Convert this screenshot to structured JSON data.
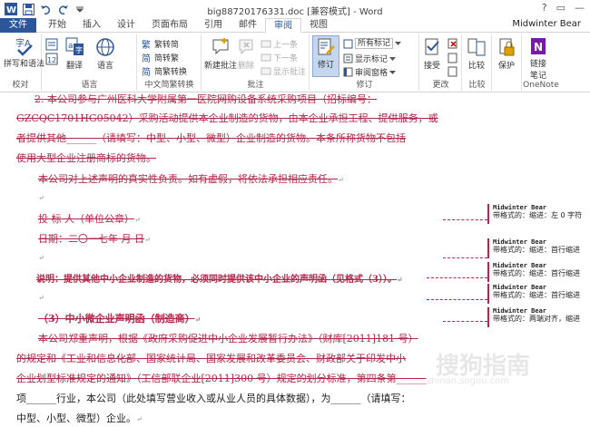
{
  "window": {
    "title": "big88720176331.doc [兼容模式] - Word",
    "controls": [
      "?",
      "▭",
      "—"
    ]
  },
  "tabs": {
    "file": "文件",
    "items": [
      "开始",
      "插入",
      "设计",
      "页面布局",
      "引用",
      "邮件",
      "审阅",
      "视图"
    ],
    "active": "审阅",
    "user": "Midwinter Bear"
  },
  "ribbon": {
    "proofing": {
      "label": "校对",
      "spelling": "拼写和语法"
    },
    "language": {
      "label": "语言",
      "translate": "翻译",
      "language": "语言"
    },
    "chinese": {
      "label": "中文简繁转换",
      "to_trad": "繁转简",
      "to_simp": "简转繁",
      "convert": "简繁转换"
    },
    "comments": {
      "label": "批注",
      "new": "新建批注",
      "delete": "删除",
      "prev": "上一条",
      "next": "下一条",
      "show": "显示批注"
    },
    "tracking": {
      "label": "修订",
      "track": "修订",
      "markup": "所有标记",
      "show_markup": "显示标记",
      "pane": "审阅窗格"
    },
    "changes": {
      "label": "更改",
      "accept": "接受"
    },
    "compare": {
      "label": "比较",
      "compare": "比较"
    },
    "protect": {
      "label": "",
      "protect": "保护"
    },
    "onenote": {
      "label": "OneNote",
      "linked": "链接",
      "notes": "笔记"
    }
  },
  "document": {
    "lines": [
      {
        "text": "2. 本公司参与广州医科大学附属第一医院网购设备系统采购项目（招标编号：",
        "style": "del"
      },
      {
        "text": "GZCQC1701HG05042）采购活动提供本企业制造的货物，由本企业承担工程、提供服务，或",
        "style": "del"
      },
      {
        "text": "者提供其他______（请填写：中型、小型、微型）企业制造的货物。本条所称货物不包括",
        "style": "del"
      },
      {
        "text": "使用大型企业注册商标的货物。",
        "style": "del"
      },
      {
        "text": "本公司对上述声明的真实性负责。如有虚假，将依法承担相应责任。",
        "style": "del"
      },
      {
        "text": "投 标 人（单位公章）",
        "style": "del"
      },
      {
        "text": "日期：二〇一七年    月    日",
        "style": "del"
      },
      {
        "text": "说明：提供其他中小企业制造的货物，必须同时提供该中小企业的声明函（见格式（3））。",
        "style": "del"
      },
      {
        "text": "（3）中小微企业声明函（制造商）",
        "style": "del"
      },
      {
        "text": "本公司郑重声明，根据《政府采购促进中小企业发展暂行办法》（财库[2011]181 号）",
        "style": "del"
      },
      {
        "text": "的规定和《工业和信息化部、国家统计局、国家发展和改革委员会、财政部关于印发中小",
        "style": "del"
      },
      {
        "text": "企业划型标准规定的通知》（工信部联企业[2011]300 号）规定的划分标准，第四条第______",
        "style": "del"
      },
      {
        "text": "项______行业，本公司（此处填写营业收入或从业人员的具体数据），为______（请填写：",
        "style": "normal"
      },
      {
        "text": "中型、小型、微型）企业。",
        "style": "normal"
      }
    ],
    "balloons": [
      {
        "author": "Midwinter Bear",
        "format": "带格式的：缩进：左  0 字符"
      },
      {
        "author": "Midwinter Bear",
        "format": "带格式的：缩进：首行缩进"
      },
      {
        "author": "Midwinter Bear",
        "format": "带格式的：缩进：首行缩进"
      },
      {
        "author": "Midwinter Bear",
        "format": "带格式的：缩进：首行缩进"
      },
      {
        "author": "Midwinter Bear",
        "format": "带格式的：两端对齐，缩进"
      }
    ],
    "watermark": "搜狗指南",
    "watermark_sub": "zhinan.sogou.com"
  }
}
